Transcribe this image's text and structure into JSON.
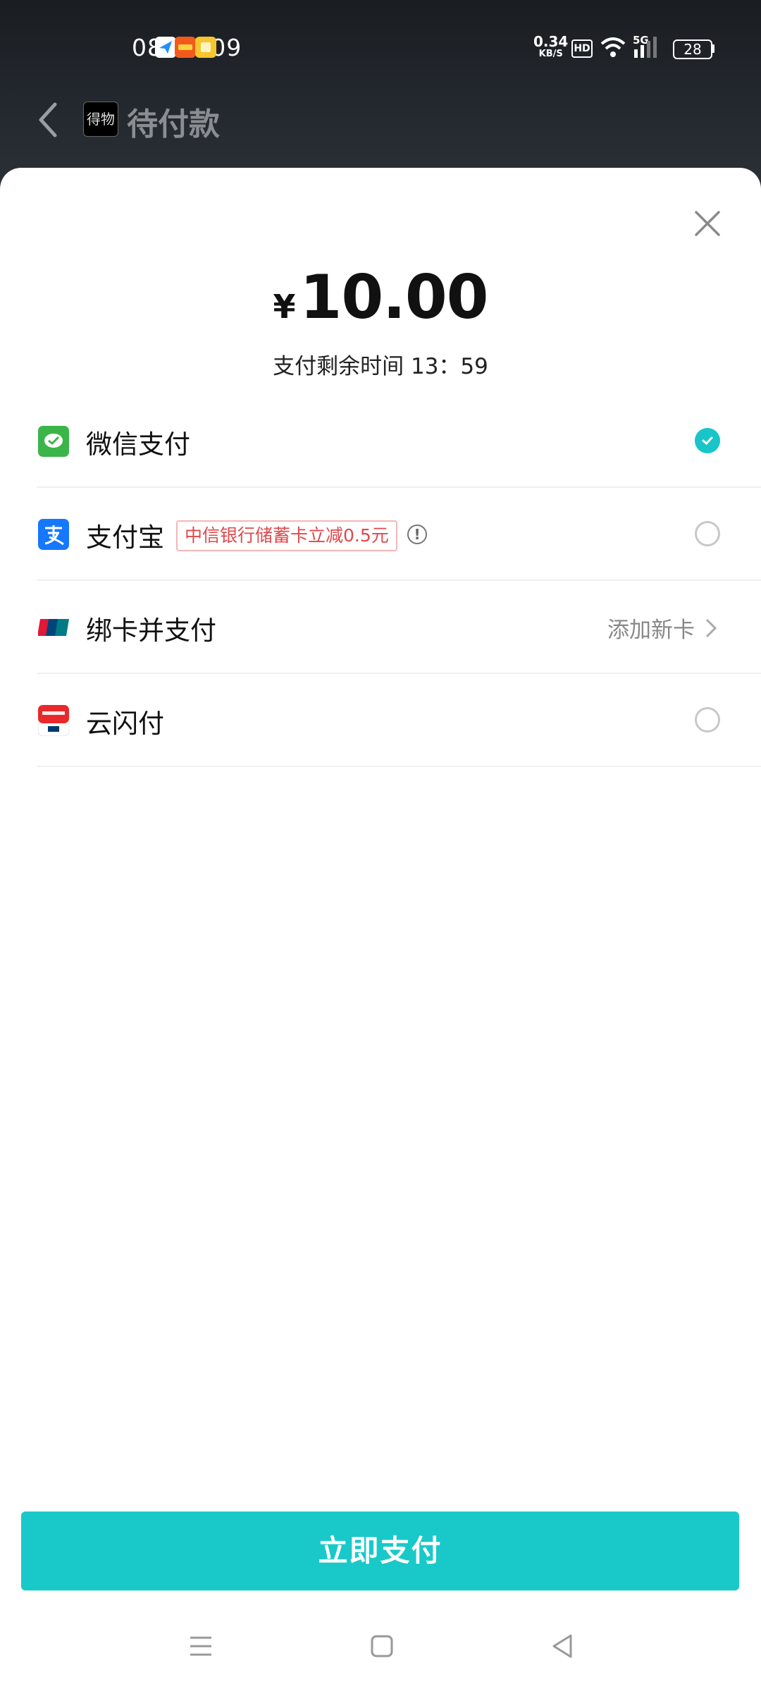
{
  "status_bar": {
    "time": "08:49:09",
    "net_speed_value": "0.34",
    "net_speed_unit": "KB/S",
    "hd": "HD",
    "network": "5G",
    "battery": "28"
  },
  "nav": {
    "logo_text": "得物",
    "title": "待付款"
  },
  "payment": {
    "currency": "¥",
    "amount": "10.00",
    "countdown": "支付剩余时间 13：59"
  },
  "methods": [
    {
      "label": "微信支付",
      "icon": "wechat-pay-icon",
      "selected": true
    },
    {
      "label": "支付宝",
      "icon": "alipay-icon",
      "promo": "中信银行储蓄卡立减0.5元",
      "selected": false
    },
    {
      "label": "绑卡并支付",
      "icon": "unionpay-icon",
      "action": "添加新卡"
    },
    {
      "label": "云闪付",
      "icon": "cloud-quickpass-icon",
      "selected": false
    }
  ],
  "pay_button": {
    "label": "立即支付"
  },
  "colors": {
    "accent": "#19c9c9",
    "promo_red": "#e0484b",
    "wechat_green": "#3bb54a",
    "alipay_blue": "#1677ff"
  }
}
